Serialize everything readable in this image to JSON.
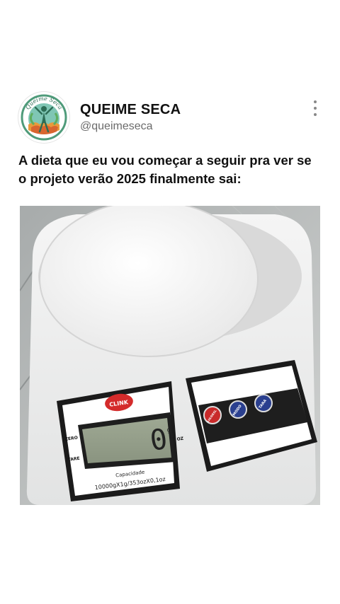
{
  "post": {
    "display_name": "QUEIME SECA",
    "handle": "@queimeseca",
    "avatar_logo_text": "Queime Seca",
    "caption": "A dieta que eu vou começar a seguir pra ver se o projeto verão 2025 finalmente sai:",
    "more_icon": "vertical-ellipsis-icon"
  },
  "media": {
    "scale": {
      "brand": "CLINK",
      "reading": "0",
      "unit": "g",
      "left_labels": [
        "ZERO",
        "TARE"
      ],
      "oz_label": "OZ",
      "capacity_label": "Capacidade",
      "capacity_spec": "10000gX1g/353ozX0,1oz",
      "buttons": [
        "LIG/DESL",
        "MODO",
        "TARA"
      ]
    }
  }
}
